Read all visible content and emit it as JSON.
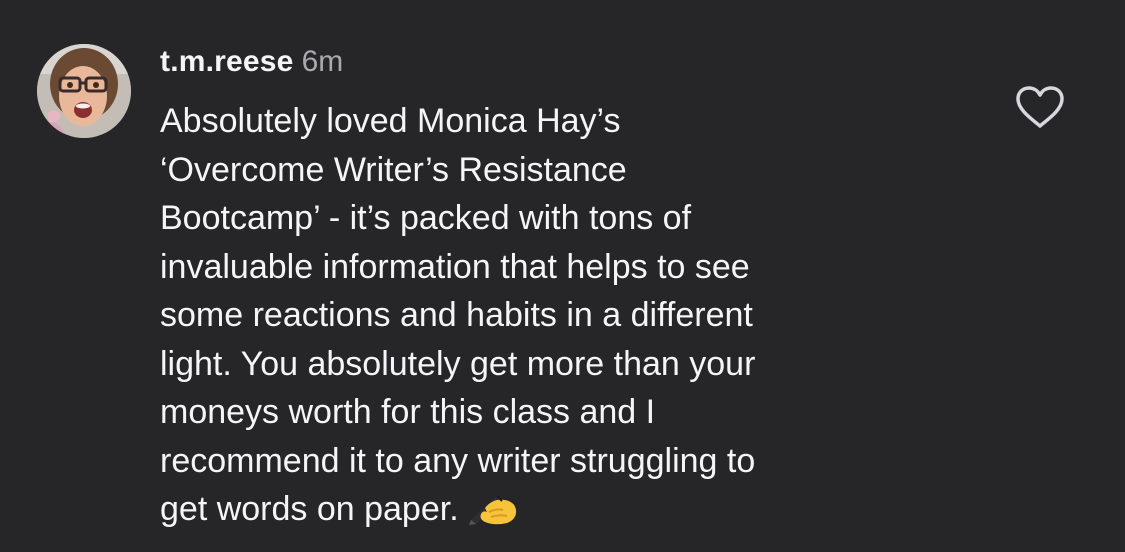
{
  "comment": {
    "username": "t.m.reese",
    "timestamp": "6m",
    "text_lines": [
      "Absolutely loved Monica Hay’s",
      "‘Overcome Writer’s Resistance",
      "Bootcamp’ - it’s packed with tons of",
      "invaluable information that helps to see",
      "some reactions and habits in a different",
      "light. You absolutely get more than your",
      "moneys worth for this class and I",
      "recommend it to any writer struggling to",
      "get words on paper."
    ],
    "trailing_emoji": "writing-hand-emoji",
    "like_icon": "heart-outline-icon"
  },
  "colors": {
    "background": "#262629",
    "text": "#f5f5f7",
    "muted_text": "#a9a9ae",
    "icon": "#d8d8dc"
  }
}
